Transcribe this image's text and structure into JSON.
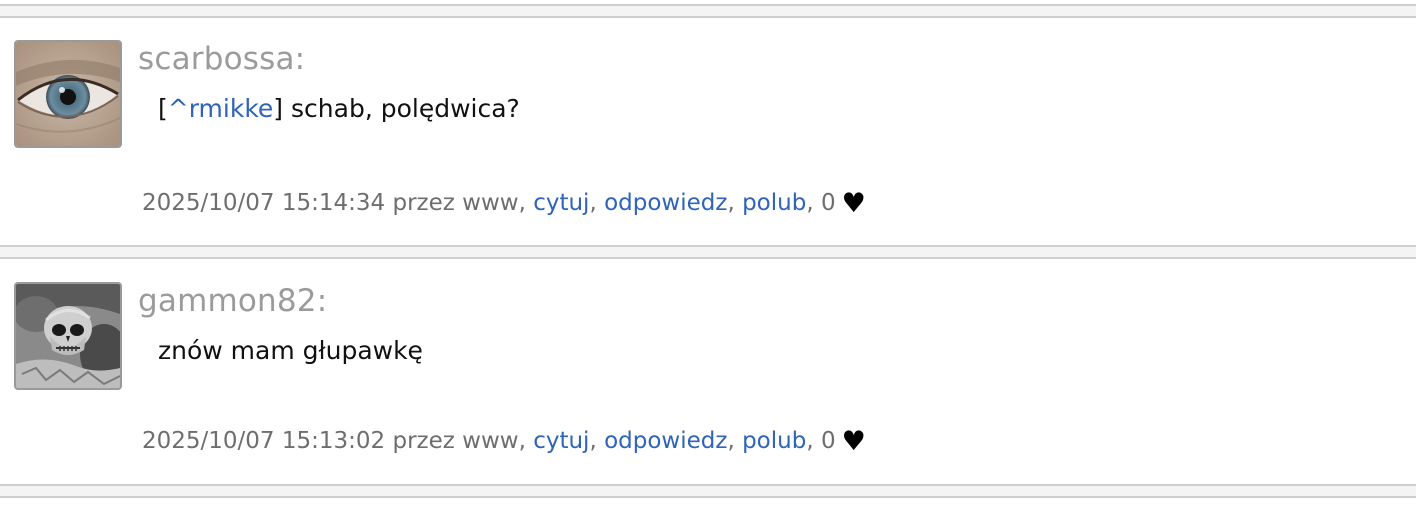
{
  "posts": [
    {
      "author": "scarbossa:",
      "avatar_icon": "eye-photo-avatar",
      "body": {
        "open_bracket": "[",
        "mention": "^rmikke",
        "close_bracket": "]",
        "text": " schab, polędwica?"
      },
      "meta": {
        "timestamp": "2025/10/07 15:14:34 przez www, ",
        "quote_label": "cytuj",
        "sep1": ", ",
        "reply_label": "odpowiedz",
        "sep2": ", ",
        "like_label": "polub",
        "sep3": ", ",
        "like_count": "0",
        "heart_icon": "♥"
      }
    },
    {
      "author": "gammon82:",
      "avatar_icon": "skull-photo-avatar",
      "body": {
        "text": "znów mam głupawkę"
      },
      "meta": {
        "timestamp": "2025/10/07 15:13:02 przez www, ",
        "quote_label": "cytuj",
        "sep1": ", ",
        "reply_label": "odpowiedz",
        "sep2": ", ",
        "like_label": "polub",
        "sep3": ", ",
        "like_count": "0",
        "heart_icon": "♥"
      }
    }
  ],
  "colors": {
    "link": "#2f64b8",
    "author": "#9b9b9b",
    "meta": "#6e6e6e",
    "separator": "#cfcfcf"
  }
}
